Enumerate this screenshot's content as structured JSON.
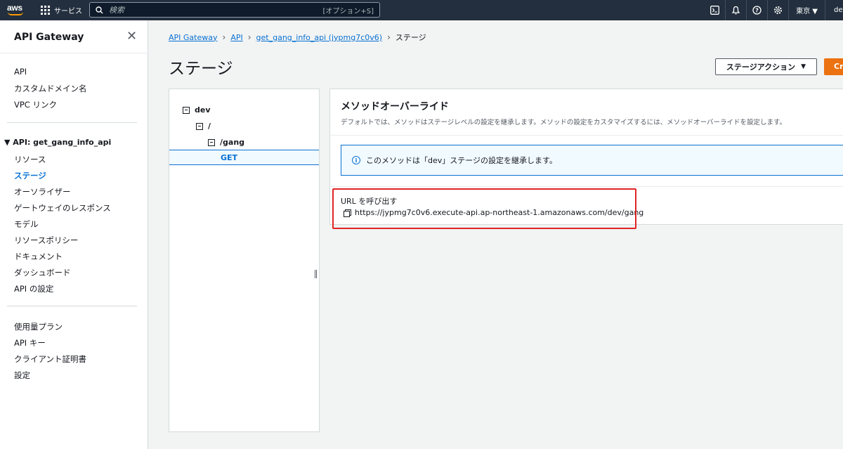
{
  "topnav": {
    "logo": "aws",
    "services_label": "サービス",
    "search_placeholder": "検索",
    "search_shortcut": "[オプション+S]",
    "region": "東京 ▼",
    "account": "dev"
  },
  "sidebar": {
    "title": "API Gateway",
    "top_items": [
      "API",
      "カスタムドメイン名",
      "VPC リンク"
    ],
    "group_label": "▼ API: get_gang_info_api",
    "group_items": [
      "リソース",
      "ステージ",
      "オーソライザー",
      "ゲートウェイのレスポンス",
      "モデル",
      "リソースポリシー",
      "ドキュメント",
      "ダッシュボード",
      "API の設定"
    ],
    "active_item": "ステージ",
    "bottom_items": [
      "使用量プラン",
      "API キー",
      "クライアント証明書",
      "設定"
    ]
  },
  "breadcrumb": {
    "items": [
      "API Gateway",
      "API",
      "get_gang_info_api (jypmg7c0v6)"
    ],
    "current": "ステージ"
  },
  "page": {
    "title": "ステージ",
    "stage_actions_label": "ステージアクション",
    "create_label": "Cr"
  },
  "tree": {
    "stage": "dev",
    "root": "/",
    "resource": "/gang",
    "method": "GET"
  },
  "detail": {
    "title": "メソッドオーバーライド",
    "description": "デフォルトでは、メソッドはステージレベルの設定を継承します。メソッドの設定をカスタマイズするには、メソッドオーバーライドを設定します。",
    "info_text": "このメソッドは「dev」ステージの設定を継承します。",
    "url_label": "URL を呼び出す",
    "invoke_url": "https://jypmg7c0v6.execute-api.ap-northeast-1.amazonaws.com/dev/gang"
  },
  "colors": {
    "nav_bg": "#232f3e",
    "link": "#0972d3",
    "accent_orange": "#ec7211",
    "highlight_red": "#e02424"
  }
}
